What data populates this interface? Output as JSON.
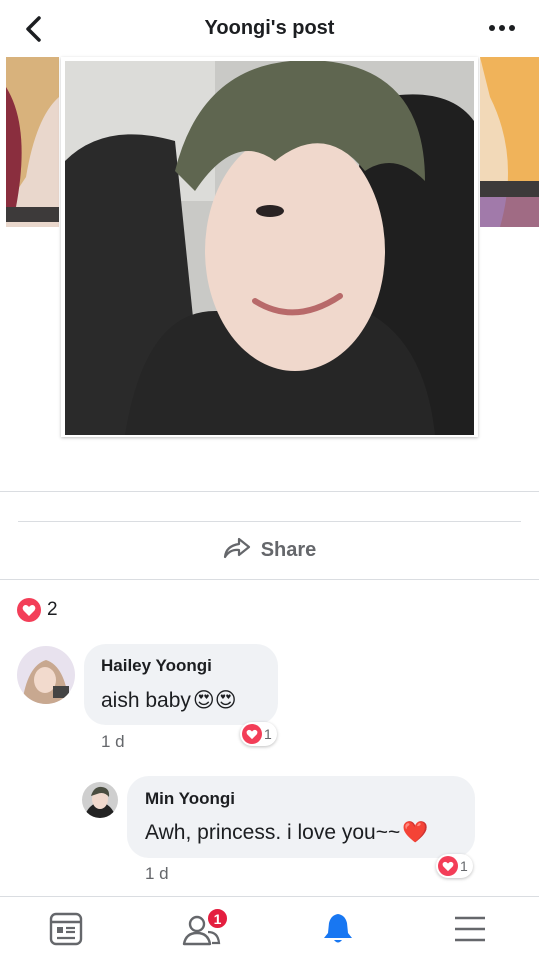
{
  "header": {
    "title": "Yoongi's post"
  },
  "actions": {
    "share_label": "Share"
  },
  "reactions": {
    "count": "2"
  },
  "comments": [
    {
      "author": "Hailey Yoongi",
      "text": "aish baby",
      "emoji": "😍😍",
      "time": "1 d",
      "reaction_count": "1"
    },
    {
      "author": "Min Yoongi",
      "text": "Awh, princess. i love you~~",
      "emoji": "❤️",
      "time": "1 d",
      "reaction_count": "1"
    }
  ],
  "tabbar": {
    "friends_badge": "1"
  },
  "colors": {
    "accent": "#1877f2",
    "heart": "#f33e58",
    "badge": "#e41e3f"
  },
  "icons": [
    "back-icon",
    "more-icon",
    "share-icon",
    "heart-icon",
    "news-feed-icon",
    "friends-icon",
    "notifications-icon",
    "menu-icon"
  ]
}
